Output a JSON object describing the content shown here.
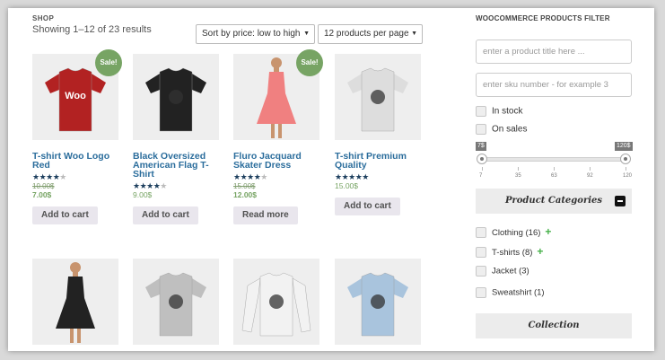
{
  "shop": {
    "label": "SHOP",
    "result_count": "Showing 1–12 of 23 results",
    "sort_value": "Sort by price: low to high",
    "per_page_value": "12 products per page"
  },
  "products": [
    {
      "title": "T-shirt Woo Logo Red",
      "rating": 4,
      "old_price": "10.00$",
      "price": "7.00$",
      "sale": "Sale!",
      "button": "Add to cart",
      "shirt_color": "#b22222",
      "logo_text": "Woo"
    },
    {
      "title": "Black Oversized American Flag T-Shirt",
      "rating": 4,
      "old_price": "",
      "price": "9.00$",
      "sale": "",
      "button": "Add to cart",
      "shirt_color": "#222222"
    },
    {
      "title": "Fluro Jacquard Skater Dress",
      "rating": 4,
      "old_price": "15.00$",
      "price": "12.00$",
      "sale": "Sale!",
      "button": "Read more",
      "shirt_color": "#f08080"
    },
    {
      "title": "T-shirt Premium Quality",
      "rating": 4.5,
      "old_price": "",
      "price": "15.00$",
      "sale": "",
      "button": "Add to cart",
      "shirt_color": "#dddddd"
    },
    {
      "title": "",
      "shirt_color": "#222222"
    },
    {
      "title": "",
      "shirt_color": "#bfbfbf"
    },
    {
      "title": "",
      "shirt_color": "#f2f2f2"
    },
    {
      "title": "",
      "shirt_color": "#a9c4dd"
    }
  ],
  "sidebar": {
    "title": "WOOCOMMERCE PRODUCTS FILTER",
    "title_placeholder": "enter a product title here ...",
    "sku_placeholder": "enter sku number - for example 3",
    "in_stock": "In stock",
    "on_sales": "On sales",
    "range_min": "7$",
    "range_max": "120$",
    "ticks": [
      "7",
      "35",
      "63",
      "92",
      "120"
    ],
    "categories_title": "Product Categories",
    "categories": [
      {
        "label": "Clothing (16)",
        "expandable": true
      },
      {
        "label": "T-shirts (8)",
        "expandable": true
      },
      {
        "label": "Jacket (3)",
        "expandable": false
      },
      {
        "label": "Sweatshirt (1)",
        "expandable": false
      }
    ],
    "collection_title": "Collection"
  },
  "icons": {
    "star": "star-icon",
    "plus": "plus-icon",
    "minus": "minus-icon",
    "arrow": "triangle-down-icon"
  },
  "colors": {
    "sale_badge": "#77a464",
    "title_link": "#2b6d9c",
    "plus": "#47b14a"
  }
}
